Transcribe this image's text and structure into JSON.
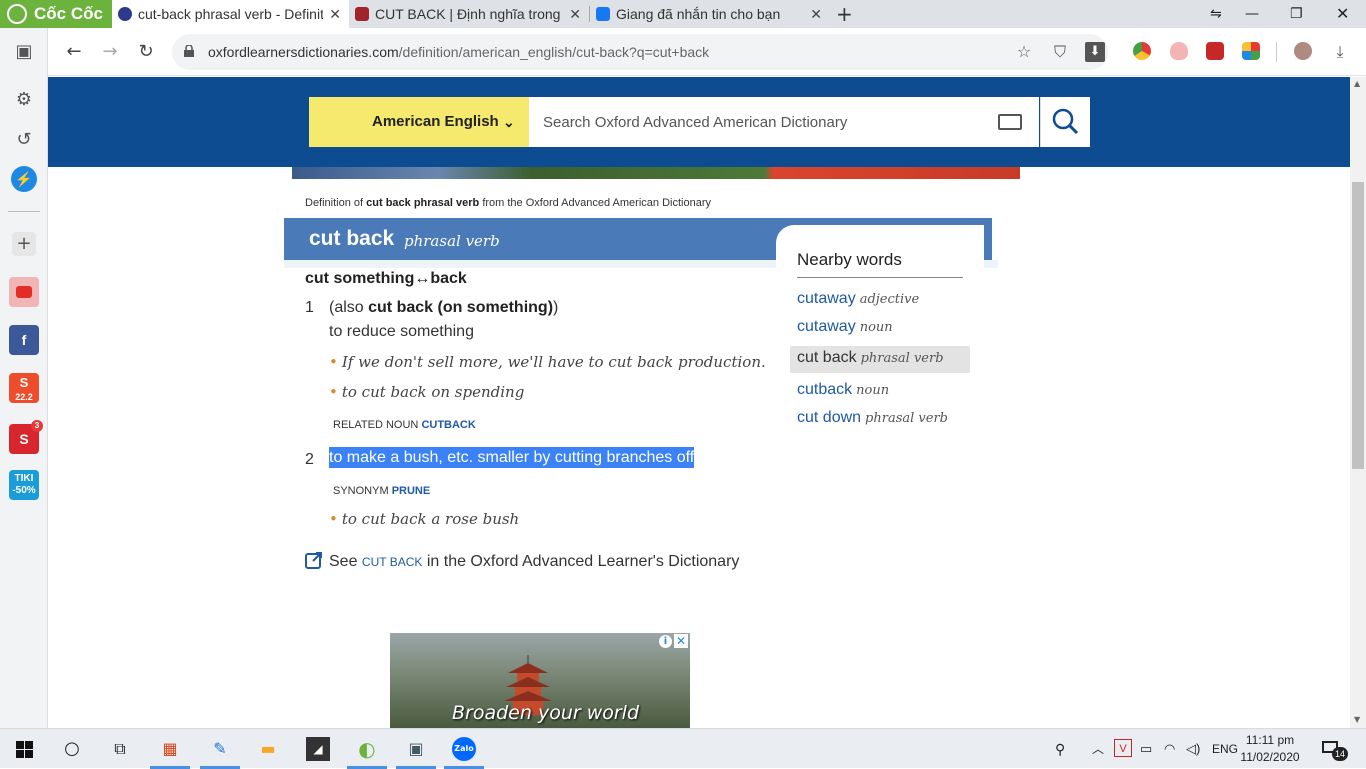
{
  "browser": {
    "brand": "Cốc Cốc",
    "tabs": [
      {
        "title": "cut-back phrasal verb - Definiti",
        "active": true
      },
      {
        "title": "CUT BACK | Định nghĩa trong",
        "active": false
      },
      {
        "title": "Giang đã nhắn tin cho bạn",
        "active": false
      }
    ],
    "url_domain": "oxfordlearnersdictionaries.com",
    "url_path": "/definition/american_english/cut-back?q=cut+back"
  },
  "header": {
    "dictionary_label": "American English",
    "search_placeholder": "Search Oxford Advanced American Dictionary"
  },
  "entry": {
    "source_prefix": "Definition of ",
    "source_term": "cut back phrasal verb",
    "source_suffix": " from the Oxford Advanced American Dictionary",
    "headword": "cut back",
    "pos": "phrasal verb",
    "phrase": "cut something↔back",
    "senses": [
      {
        "num": "1",
        "also_pre": "(also ",
        "also_term": "cut back (on something)",
        "also_post": ")",
        "definition": "to reduce something",
        "examples": [
          "If we don't sell more, we'll have to cut back production.",
          "to cut back on spending"
        ],
        "related_label": "RELATED NOUN",
        "related_link": "CUTBACK"
      },
      {
        "num": "2",
        "definition": "to make a bush, etc. smaller by cutting branches off",
        "synonym_label": "SYNONYM",
        "synonym_link": "PRUNE",
        "examples": [
          "to cut back a rose bush"
        ]
      }
    ],
    "see_pre": "See",
    "see_link": "cut back",
    "see_post": "in the Oxford Advanced Learner's Dictionary"
  },
  "nearby": {
    "title": "Nearby words",
    "items": [
      {
        "word": "cutaway",
        "pos": "adjective"
      },
      {
        "word": "cutaway",
        "pos": "noun"
      },
      {
        "word": "cut back",
        "pos": "phrasal verb",
        "current": true
      },
      {
        "word": "cutback",
        "pos": "noun"
      },
      {
        "word": "cut down",
        "pos": "phrasal verb"
      }
    ]
  },
  "ad": {
    "caption": "Broaden your world",
    "info": "i",
    "close": "✕"
  },
  "taskbar": {
    "lang": "ENG",
    "time": "11:11 pm",
    "date": "11/02/2020",
    "notifications": "14"
  },
  "sidebar": {
    "shopee_badge": "22.2",
    "sendo_badge": "3",
    "tiki_label": "TIKI",
    "tiki_offer": "-50%"
  },
  "colors": {
    "header_blue": "#0e4c92",
    "headword_bar": "#4a7ab8",
    "dict_yellow": "#f5e96e",
    "link_blue": "#1f5aa3",
    "selection": "#3b82f6",
    "brand_green": "#6cb33e"
  }
}
